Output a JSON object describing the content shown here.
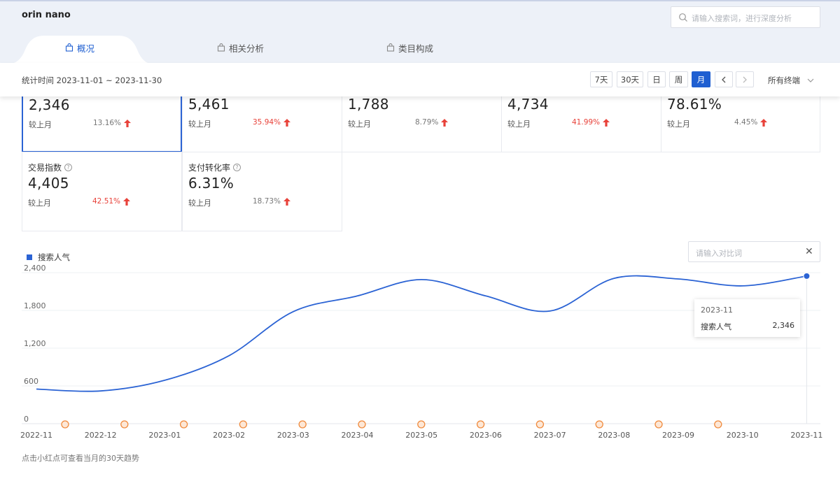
{
  "header": {
    "product_name": "orin nano",
    "search_placeholder": "请输入搜索词，进行深度分析"
  },
  "tabs": [
    {
      "label": "概况",
      "active": true
    },
    {
      "label": "相关分析",
      "active": false
    },
    {
      "label": "类目构成",
      "active": false
    }
  ],
  "stat_bar": {
    "time_range": "统计时间 2023-11-01 ~ 2023-11-30",
    "periods": [
      "7天",
      "30天",
      "日",
      "周",
      "月"
    ],
    "active_period": "月",
    "terminal": "所有终端"
  },
  "metrics": [
    {
      "name": "",
      "value": "2,346",
      "compare_label": "较上月",
      "change": "13.16%",
      "change_color": "#777777"
    },
    {
      "name": "",
      "value": "5,461",
      "compare_label": "较上月",
      "change": "35.94%",
      "change_color": "#e8423a"
    },
    {
      "name": "",
      "value": "1,788",
      "compare_label": "较上月",
      "change": "8.79%",
      "change_color": "#777777"
    },
    {
      "name": "",
      "value": "4,734",
      "compare_label": "较上月",
      "change": "41.99%",
      "change_color": "#e8423a"
    },
    {
      "name": "",
      "value": "78.61%",
      "compare_label": "较上月",
      "change": "4.45%",
      "change_color": "#777777"
    },
    {
      "name": "交易指数",
      "value": "4,405",
      "compare_label": "较上月",
      "change": "42.51%",
      "change_color": "#e8423a"
    },
    {
      "name": "支付转化率",
      "value": "6.31%",
      "compare_label": "较上月",
      "change": "18.73%",
      "change_color": "#777777"
    }
  ],
  "compare_input_placeholder": "请输入对比词",
  "chart_data": {
    "type": "line",
    "x": [
      "2022-11",
      "2022-12",
      "2023-01",
      "2023-02",
      "2023-03",
      "2023-04",
      "2023-05",
      "2023-06",
      "2023-07",
      "2023-08",
      "2023-09",
      "2023-10",
      "2023-11"
    ],
    "series": [
      {
        "name": "搜索人气",
        "color": "#2b63d4",
        "values": [
          550,
          520,
          690,
          1080,
          1780,
          2030,
          2290,
          2030,
          1790,
          2310,
          2300,
          2190,
          2346
        ]
      }
    ],
    "y_ticks": [
      "0",
      "600",
      "1,200",
      "1,800",
      "2,400"
    ],
    "ylim": [
      0,
      2400
    ],
    "grid": true
  },
  "tooltip": {
    "month": "2023-11",
    "label": "搜索人气",
    "value": "2,346"
  },
  "hint": "点击小红点可查看当月的30天趋势",
  "colors": {
    "accent": "#2b63d4",
    "up": "#e8423a",
    "event_dot": "#f08a3c"
  }
}
